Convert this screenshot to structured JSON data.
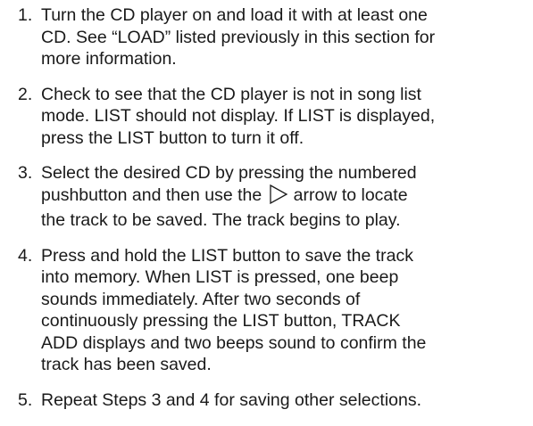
{
  "steps": [
    {
      "number": "1.",
      "lines": [
        "Turn the CD player on and load it with at least one",
        "CD. See “LOAD” listed previously in this section for",
        "more information."
      ]
    },
    {
      "number": "2.",
      "lines": [
        "Check to see that the CD player is not in song list",
        "mode. LIST should not display. If LIST is displayed,",
        "press the LIST button to turn it off."
      ]
    },
    {
      "number": "3.",
      "line1": "Select the desired CD by pressing the numbered",
      "line2_before": "pushbutton and then use the",
      "arrow_icon": "play-arrow-outline-icon",
      "line2_after": "arrow to locate",
      "line3": "the track to be saved. The track begins to play."
    },
    {
      "number": "4.",
      "lines": [
        "Press and hold the LIST button to save the track",
        "into memory. When LIST is pressed, one beep",
        "sounds immediately. After two seconds of",
        "continuously pressing the LIST button, TRACK",
        "ADD displays and two beeps sound to confirm the",
        "track has been saved."
      ]
    },
    {
      "number": "5.",
      "lines": [
        "Repeat Steps 3 and 4 for saving other selections."
      ]
    }
  ]
}
